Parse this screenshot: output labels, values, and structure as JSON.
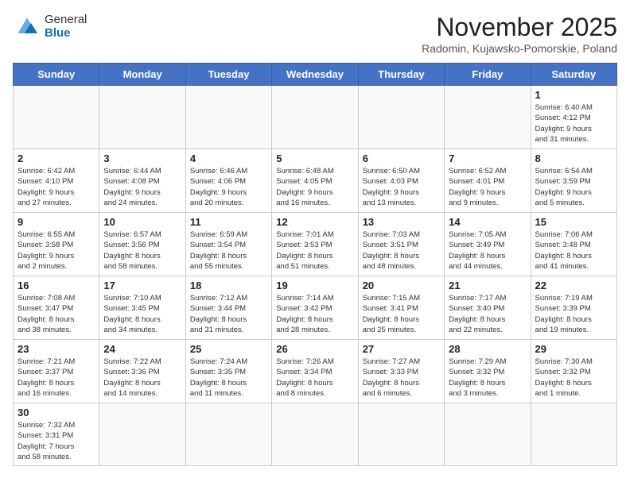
{
  "header": {
    "logo_general": "General",
    "logo_blue": "Blue",
    "month": "November 2025",
    "location": "Radomin, Kujawsko-Pomorskie, Poland"
  },
  "weekdays": [
    "Sunday",
    "Monday",
    "Tuesday",
    "Wednesday",
    "Thursday",
    "Friday",
    "Saturday"
  ],
  "weeks": [
    [
      {
        "day": "",
        "info": ""
      },
      {
        "day": "",
        "info": ""
      },
      {
        "day": "",
        "info": ""
      },
      {
        "day": "",
        "info": ""
      },
      {
        "day": "",
        "info": ""
      },
      {
        "day": "",
        "info": ""
      },
      {
        "day": "1",
        "info": "Sunrise: 6:40 AM\nSunset: 4:12 PM\nDaylight: 9 hours\nand 31 minutes."
      }
    ],
    [
      {
        "day": "2",
        "info": "Sunrise: 6:42 AM\nSunset: 4:10 PM\nDaylight: 9 hours\nand 27 minutes."
      },
      {
        "day": "3",
        "info": "Sunrise: 6:44 AM\nSunset: 4:08 PM\nDaylight: 9 hours\nand 24 minutes."
      },
      {
        "day": "4",
        "info": "Sunrise: 6:46 AM\nSunset: 4:06 PM\nDaylight: 9 hours\nand 20 minutes."
      },
      {
        "day": "5",
        "info": "Sunrise: 6:48 AM\nSunset: 4:05 PM\nDaylight: 9 hours\nand 16 minutes."
      },
      {
        "day": "6",
        "info": "Sunrise: 6:50 AM\nSunset: 4:03 PM\nDaylight: 9 hours\nand 13 minutes."
      },
      {
        "day": "7",
        "info": "Sunrise: 6:52 AM\nSunset: 4:01 PM\nDaylight: 9 hours\nand 9 minutes."
      },
      {
        "day": "8",
        "info": "Sunrise: 6:54 AM\nSunset: 3:59 PM\nDaylight: 9 hours\nand 5 minutes."
      }
    ],
    [
      {
        "day": "9",
        "info": "Sunrise: 6:55 AM\nSunset: 3:58 PM\nDaylight: 9 hours\nand 2 minutes."
      },
      {
        "day": "10",
        "info": "Sunrise: 6:57 AM\nSunset: 3:56 PM\nDaylight: 8 hours\nand 58 minutes."
      },
      {
        "day": "11",
        "info": "Sunrise: 6:59 AM\nSunset: 3:54 PM\nDaylight: 8 hours\nand 55 minutes."
      },
      {
        "day": "12",
        "info": "Sunrise: 7:01 AM\nSunset: 3:53 PM\nDaylight: 8 hours\nand 51 minutes."
      },
      {
        "day": "13",
        "info": "Sunrise: 7:03 AM\nSunset: 3:51 PM\nDaylight: 8 hours\nand 48 minutes."
      },
      {
        "day": "14",
        "info": "Sunrise: 7:05 AM\nSunset: 3:49 PM\nDaylight: 8 hours\nand 44 minutes."
      },
      {
        "day": "15",
        "info": "Sunrise: 7:06 AM\nSunset: 3:48 PM\nDaylight: 8 hours\nand 41 minutes."
      }
    ],
    [
      {
        "day": "16",
        "info": "Sunrise: 7:08 AM\nSunset: 3:47 PM\nDaylight: 8 hours\nand 38 minutes."
      },
      {
        "day": "17",
        "info": "Sunrise: 7:10 AM\nSunset: 3:45 PM\nDaylight: 8 hours\nand 34 minutes."
      },
      {
        "day": "18",
        "info": "Sunrise: 7:12 AM\nSunset: 3:44 PM\nDaylight: 8 hours\nand 31 minutes."
      },
      {
        "day": "19",
        "info": "Sunrise: 7:14 AM\nSunset: 3:42 PM\nDaylight: 8 hours\nand 28 minutes."
      },
      {
        "day": "20",
        "info": "Sunrise: 7:15 AM\nSunset: 3:41 PM\nDaylight: 8 hours\nand 25 minutes."
      },
      {
        "day": "21",
        "info": "Sunrise: 7:17 AM\nSunset: 3:40 PM\nDaylight: 8 hours\nand 22 minutes."
      },
      {
        "day": "22",
        "info": "Sunrise: 7:19 AM\nSunset: 3:39 PM\nDaylight: 8 hours\nand 19 minutes."
      }
    ],
    [
      {
        "day": "23",
        "info": "Sunrise: 7:21 AM\nSunset: 3:37 PM\nDaylight: 8 hours\nand 16 minutes."
      },
      {
        "day": "24",
        "info": "Sunrise: 7:22 AM\nSunset: 3:36 PM\nDaylight: 8 hours\nand 14 minutes."
      },
      {
        "day": "25",
        "info": "Sunrise: 7:24 AM\nSunset: 3:35 PM\nDaylight: 8 hours\nand 11 minutes."
      },
      {
        "day": "26",
        "info": "Sunrise: 7:26 AM\nSunset: 3:34 PM\nDaylight: 8 hours\nand 8 minutes."
      },
      {
        "day": "27",
        "info": "Sunrise: 7:27 AM\nSunset: 3:33 PM\nDaylight: 8 hours\nand 6 minutes."
      },
      {
        "day": "28",
        "info": "Sunrise: 7:29 AM\nSunset: 3:32 PM\nDaylight: 8 hours\nand 3 minutes."
      },
      {
        "day": "29",
        "info": "Sunrise: 7:30 AM\nSunset: 3:32 PM\nDaylight: 8 hours\nand 1 minute."
      }
    ],
    [
      {
        "day": "30",
        "info": "Sunrise: 7:32 AM\nSunset: 3:31 PM\nDaylight: 7 hours\nand 58 minutes."
      },
      {
        "day": "",
        "info": ""
      },
      {
        "day": "",
        "info": ""
      },
      {
        "day": "",
        "info": ""
      },
      {
        "day": "",
        "info": ""
      },
      {
        "day": "",
        "info": ""
      },
      {
        "day": "",
        "info": ""
      }
    ]
  ]
}
